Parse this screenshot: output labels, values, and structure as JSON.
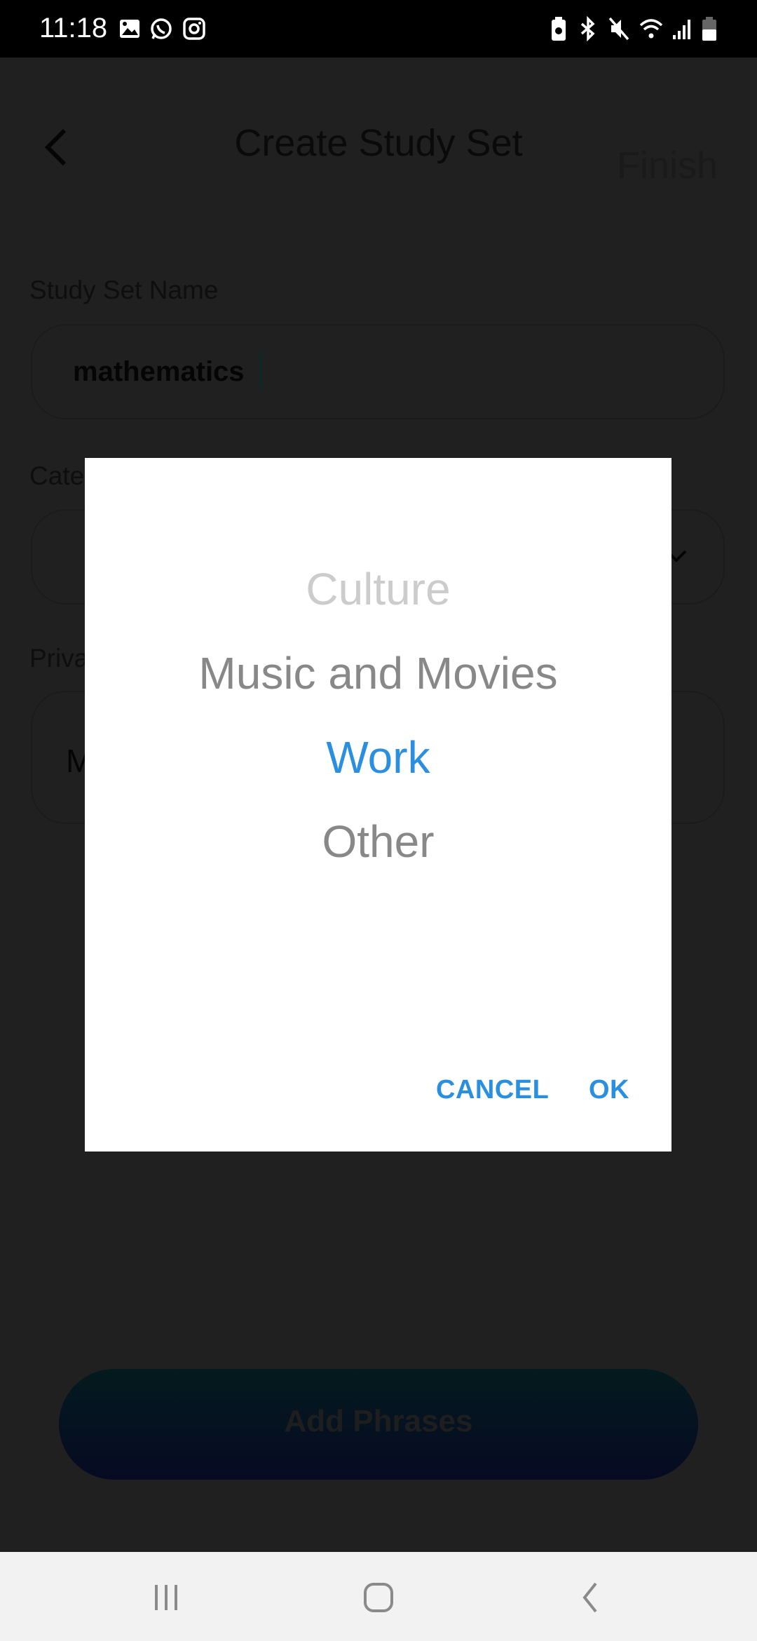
{
  "status_bar": {
    "time": "11:18",
    "left_icons": [
      "gallery-icon",
      "whatsapp-icon",
      "instagram-icon"
    ],
    "right_icons": [
      "battery-saver-icon",
      "bluetooth-icon",
      "mute-icon",
      "wifi-icon",
      "signal-icon",
      "battery-icon"
    ]
  },
  "header": {
    "title": "Create Study Set",
    "finish_label": "Finish"
  },
  "form": {
    "name_label": "Study Set Name",
    "name_value": "mathematics",
    "category_label": "Cate",
    "privacy_label": "Priva",
    "privacy_value": "M"
  },
  "add_phrases_label": "Add Phrases",
  "picker_dialog": {
    "options": [
      "Culture",
      "Music and Movies",
      "Work",
      "Other"
    ],
    "selected": "Work",
    "cancel_label": "CANCEL",
    "ok_label": "OK",
    "colors": {
      "accent": "#2b8fdf",
      "option": "#888888",
      "faded": "#cccccc"
    }
  },
  "nav_bar": [
    "recent-apps-icon",
    "home-icon",
    "back-icon"
  ]
}
